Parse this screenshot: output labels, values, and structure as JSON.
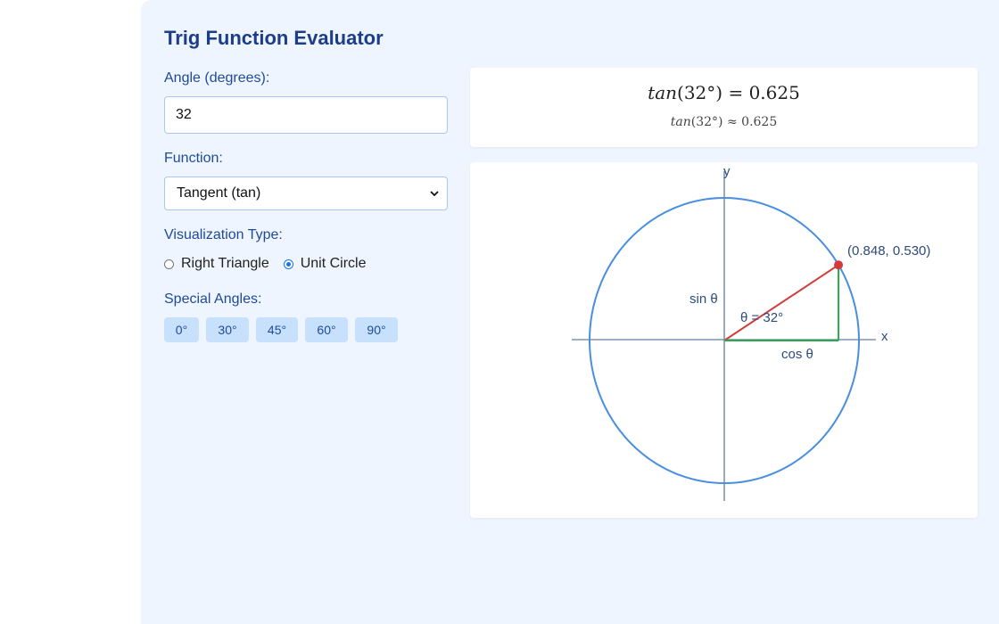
{
  "app": {
    "title": "Trig Function Evaluator"
  },
  "angle": {
    "label": "Angle (degrees):",
    "value": "32"
  },
  "function": {
    "label": "Function:",
    "selected": "Tangent (tan)"
  },
  "visualization": {
    "label": "Visualization Type:",
    "options": [
      {
        "label": "Right Triangle",
        "checked": false
      },
      {
        "label": "Unit Circle",
        "checked": true
      }
    ]
  },
  "special_angles": {
    "label": "Special Angles:",
    "buttons": [
      "0°",
      "30°",
      "45°",
      "60°",
      "90°"
    ]
  },
  "result": {
    "fn": "tan",
    "angle_text": "32°",
    "equals": "=",
    "value": "0.625",
    "approx": "≈",
    "approx_value": "0.625"
  },
  "diagram": {
    "x_axis_label": "x",
    "y_axis_label": "y",
    "point_label": "(0.848, 0.530)",
    "sin_label": "sin θ",
    "cos_label": "cos θ",
    "theta_label": "θ = 32°",
    "angle_degrees": 32,
    "colors": {
      "circle": "#4a8ee0",
      "axis": "#7d94b4",
      "radius": "#d33b3b",
      "legs": "#2aa84a",
      "point": "#d33b3b",
      "label": "#2d4a7c"
    }
  }
}
